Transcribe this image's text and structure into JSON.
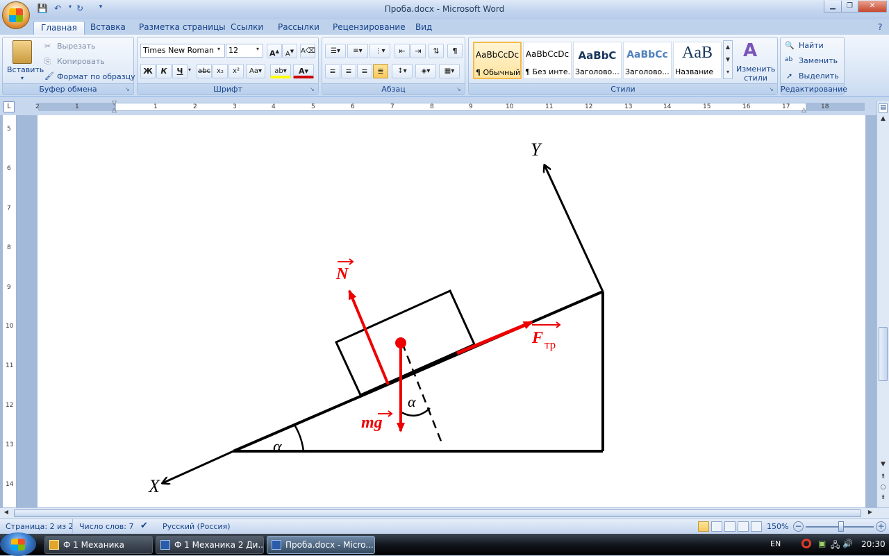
{
  "window": {
    "title": "Проба.docx - Microsoft Word"
  },
  "tabs": [
    "Главная",
    "Вставка",
    "Разметка страницы",
    "Ссылки",
    "Рассылки",
    "Рецензирование",
    "Вид"
  ],
  "clipboard": {
    "label": "Буфер обмена",
    "paste": "Вставить",
    "cut": "Вырезать",
    "copy": "Копировать",
    "format_painter": "Формат по образцу"
  },
  "font": {
    "label": "Шрифт",
    "name": "Times New Roman",
    "size": "12"
  },
  "paragraph": {
    "label": "Абзац"
  },
  "styles": {
    "label": "Стили",
    "items": [
      {
        "preview": "AaBbCcDc",
        "name": "¶ Обычный"
      },
      {
        "preview": "AaBbCcDc",
        "name": "¶ Без инте..."
      },
      {
        "preview": "AaBbC",
        "name": "Заголово..."
      },
      {
        "preview": "AaBbCc",
        "name": "Заголово..."
      },
      {
        "preview": "AaB",
        "name": "Название"
      }
    ],
    "change": "Изменить стили"
  },
  "editing": {
    "label": "Редактирование",
    "find": "Найти",
    "replace": "Заменить",
    "select": "Выделить"
  },
  "ruler": {
    "numbers": [
      "2",
      "1",
      "1",
      "2",
      "3",
      "4",
      "5",
      "6",
      "7",
      "8",
      "9",
      "10",
      "11",
      "12",
      "13",
      "14",
      "15",
      "16",
      "17",
      "18"
    ],
    "vnumbers": [
      "5",
      "6",
      "7",
      "8",
      "9",
      "10",
      "11",
      "12",
      "13",
      "14"
    ]
  },
  "diagram": {
    "axis_x": "X",
    "axis_y": "Y",
    "force_normal": "N",
    "force_friction": "F",
    "friction_sub": "тр",
    "gravity": "mg",
    "gravity_vec": "g",
    "angle": "α"
  },
  "status": {
    "page": "Страница: 2 из 2",
    "words": "Число слов: 7",
    "language": "Русский (Россия)",
    "zoom": "150%"
  },
  "taskbar": {
    "items": [
      "Ф 1 Механика",
      "Ф 1 Механика 2 Ди...",
      "Проба.docx - Micro..."
    ],
    "lang": "EN",
    "time": "20:30"
  },
  "colors": {
    "force": "#ee0000",
    "ribbon": "#dbe7f6",
    "text": "#15428b"
  }
}
